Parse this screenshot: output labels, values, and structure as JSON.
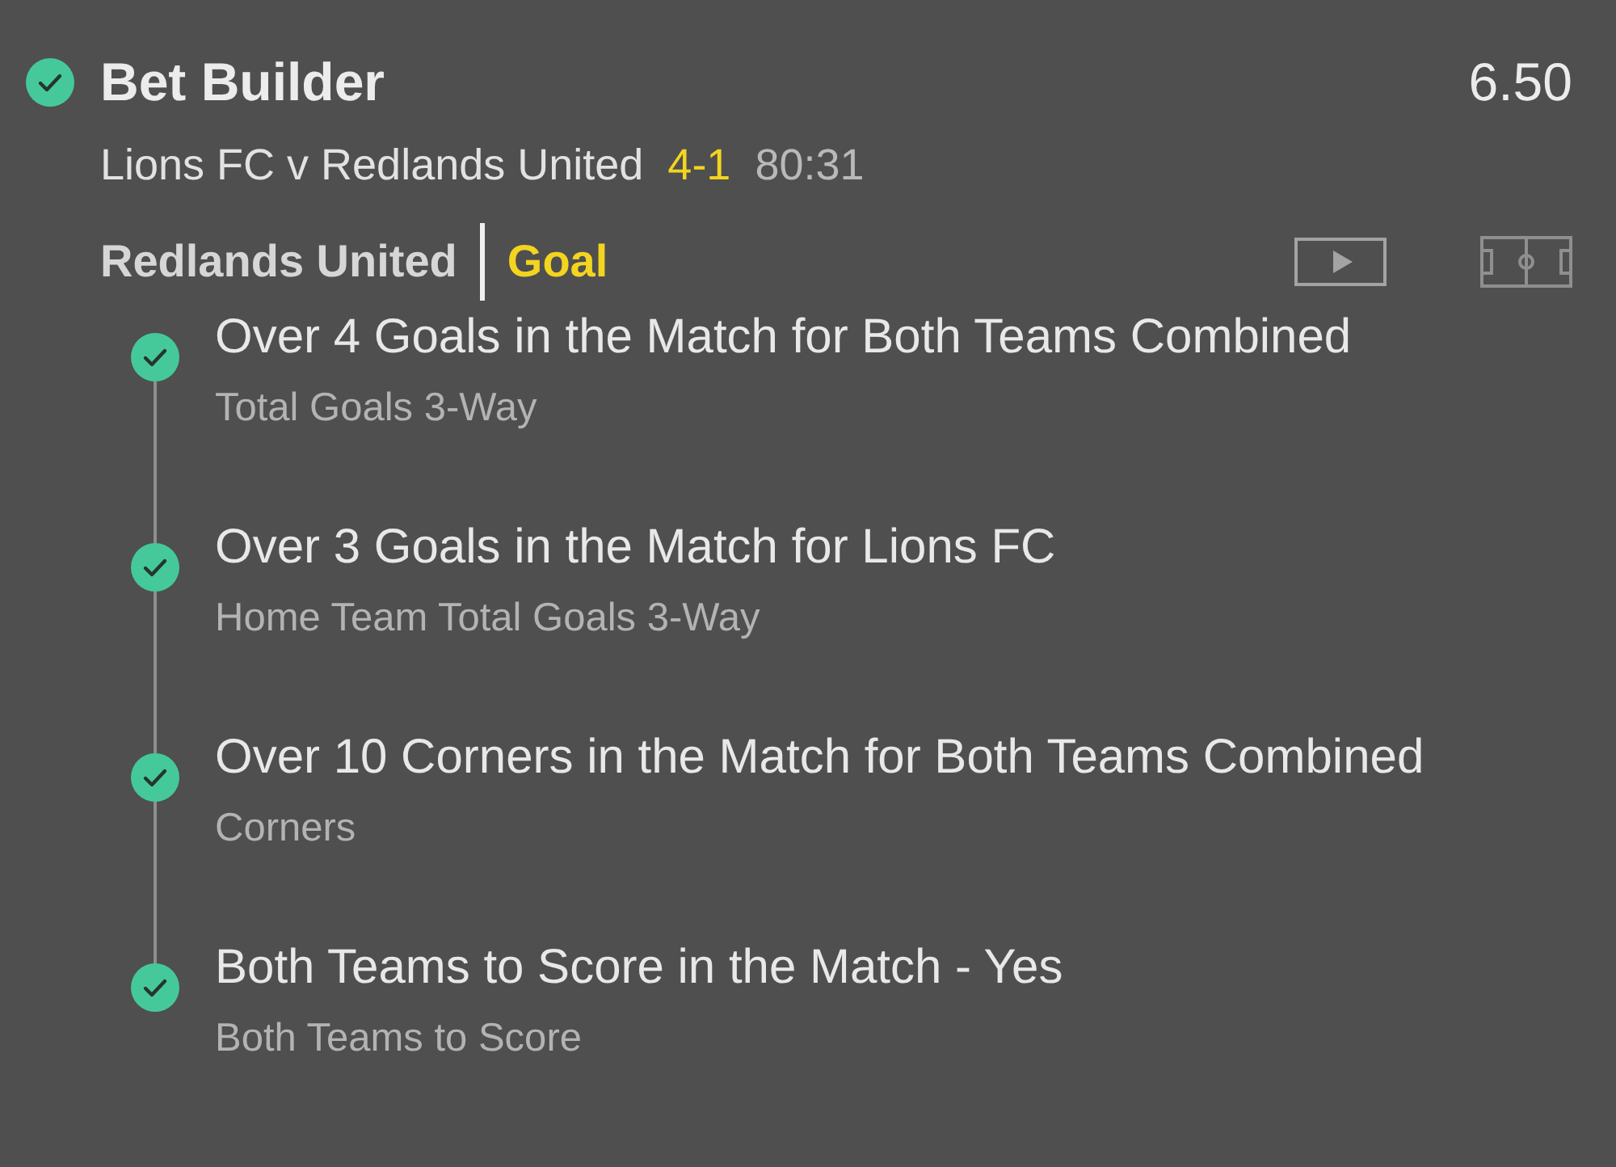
{
  "bet": {
    "won": true,
    "title": "Bet Builder",
    "odds": "6.50"
  },
  "match": {
    "teams": "Lions FC v Redlands United",
    "score": "4-1",
    "clock": "80:31"
  },
  "event": {
    "team": "Redlands United",
    "type": "Goal"
  },
  "selections": [
    {
      "won": true,
      "name": "Over 4 Goals in the Match for Both Teams Combined",
      "market": "Total Goals 3-Way"
    },
    {
      "won": true,
      "name": "Over 3 Goals in the Match for Lions FC",
      "market": "Home Team Total Goals 3-Way"
    },
    {
      "won": true,
      "name": "Over 10 Corners in the Match for Both Teams Combined",
      "market": "Corners"
    },
    {
      "won": true,
      "name": "Both Teams to Score in the Match - Yes",
      "market": "Both Teams to Score"
    }
  ]
}
